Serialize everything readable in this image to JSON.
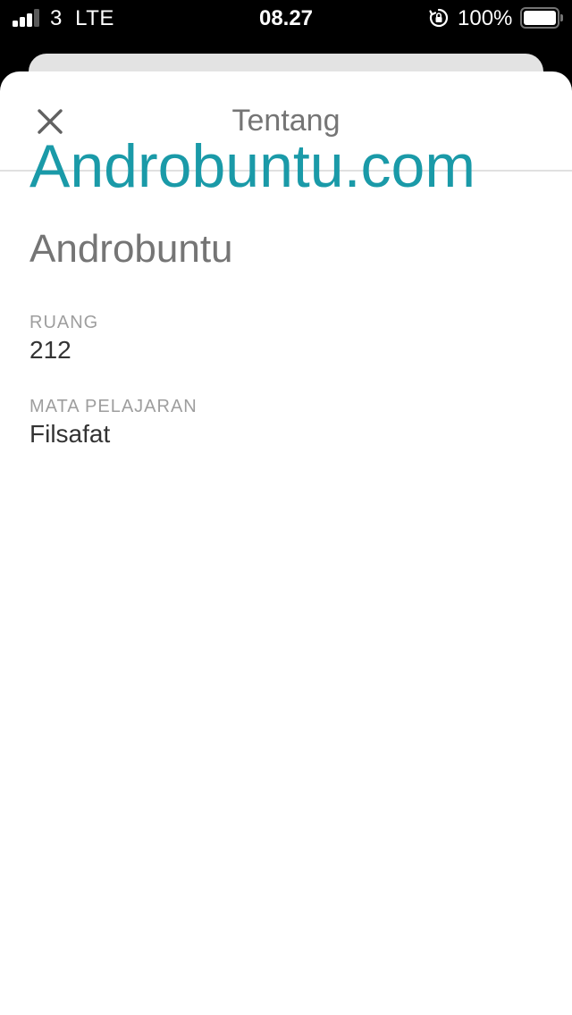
{
  "status_bar": {
    "carrier": "3  LTE",
    "time": "08.27",
    "battery": "100%",
    "icons": [
      "signal-icon",
      "rotation-lock-icon",
      "battery-icon"
    ]
  },
  "header": {
    "title": "Tentang",
    "close_icon": "close-icon"
  },
  "class_info": {
    "name": "Androbuntu.com",
    "section": "Androbuntu",
    "room_label": "RUANG",
    "room_value": "212",
    "subject_label": "MATA PELAJARAN",
    "subject_value": "Filsafat"
  },
  "colors": {
    "accent": "#1a9aa8",
    "title_gray": "#757575",
    "label_gray": "#9e9e9e"
  }
}
